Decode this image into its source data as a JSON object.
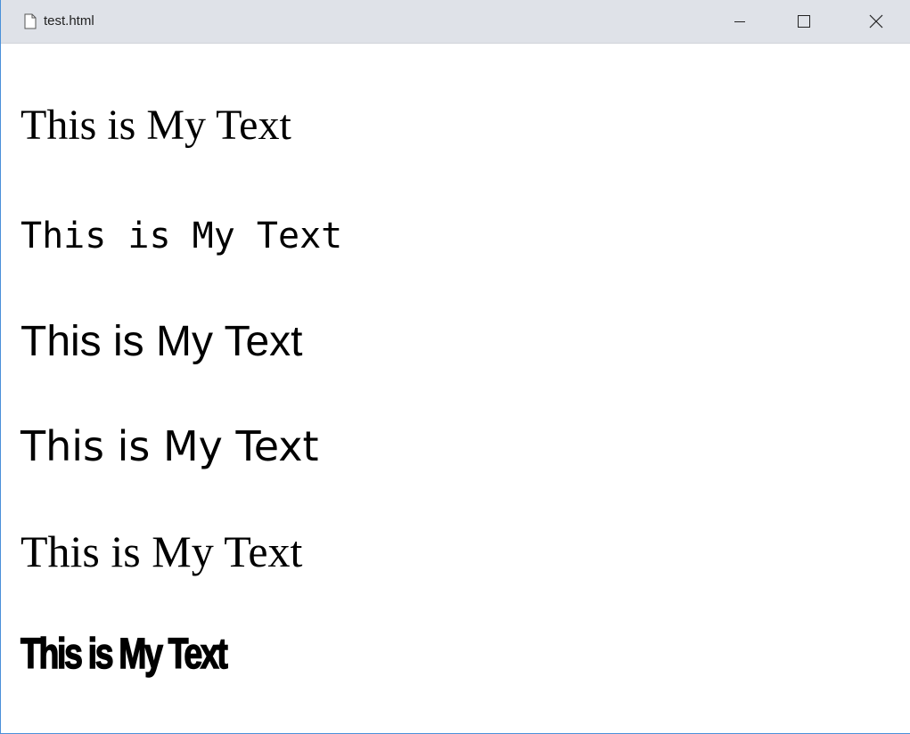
{
  "window": {
    "title": "test.html",
    "controls": {
      "minimize_icon": "minimize-icon",
      "maximize_icon": "maximize-icon",
      "close_icon": "close-icon"
    },
    "colors": {
      "titlebar": "#dfe2e8",
      "border": "#4a90d9",
      "text": "#000000"
    }
  },
  "page": {
    "lines": [
      "This is My Text",
      "This is My Text",
      "This is My Text",
      "This is My Text",
      "This is My Text",
      "This is My Text"
    ]
  }
}
